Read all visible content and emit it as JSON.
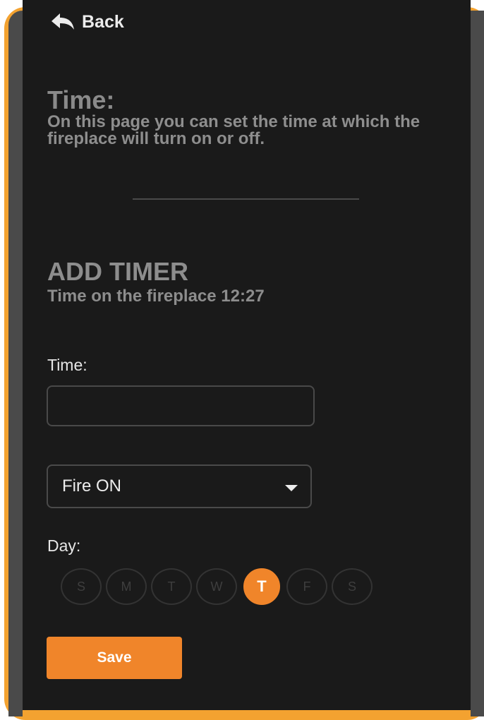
{
  "header": {
    "back_label": "Back",
    "back_icon": "arrow-back-icon"
  },
  "intro": {
    "title": "Time:",
    "description": "On this page you can set the time at which the fireplace will turn on or off."
  },
  "add_timer": {
    "title": "ADD TIMER",
    "subtitle": "Time on the fireplace 12:27"
  },
  "form": {
    "time_label": "Time:",
    "time_value": "",
    "mode_select": {
      "selected": "Fire ON",
      "icon": "chevron-down-icon"
    },
    "day_label": "Day:",
    "days": [
      {
        "label": "S",
        "active": false
      },
      {
        "label": "M",
        "active": false
      },
      {
        "label": "T",
        "active": false
      },
      {
        "label": "W",
        "active": false
      },
      {
        "label": "T",
        "active": true
      },
      {
        "label": "F",
        "active": false
      },
      {
        "label": "S",
        "active": false
      }
    ],
    "save_label": "Save"
  },
  "colors": {
    "accent": "#f0852a",
    "frame": "#f3a230",
    "background": "#1a1a1a"
  }
}
